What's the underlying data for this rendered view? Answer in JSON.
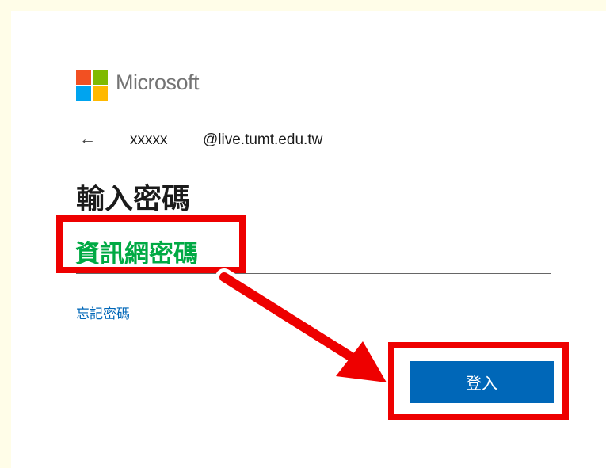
{
  "brand": {
    "name": "Microsoft"
  },
  "account": {
    "username": "xxxxx",
    "domain": "@live.tumt.edu.tw"
  },
  "page": {
    "title": "輸入密碼"
  },
  "form": {
    "password_value": "",
    "forgot_label": "忘記密碼",
    "signin_label": "登入"
  },
  "annotation": {
    "note": "資訊網密碼",
    "color": "#ee0000",
    "note_color": "#00aa44"
  },
  "colors": {
    "accent": "#0067b8",
    "background": "#fffde8"
  }
}
